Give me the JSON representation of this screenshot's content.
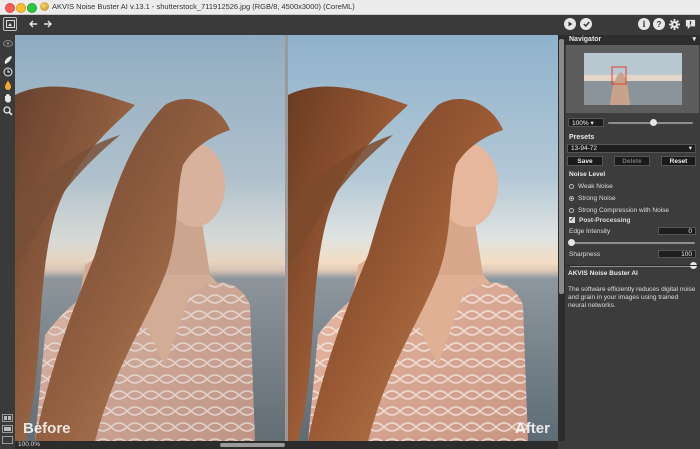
{
  "window": {
    "title": "AKVIS Noise Buster AI v.13.1 - shutterstock_711912526.jpg (RGB/8, 4500x3000) (CoreML)"
  },
  "toolbar": {
    "back_icon": "arrow-left",
    "forward_icon": "arrow-right",
    "run_icon": "play",
    "apply_icon": "check",
    "info_icon": "i",
    "help_icon": "?",
    "settings_icon": "gear",
    "feedback_icon": "!"
  },
  "canvas": {
    "before_label": "Before",
    "after_label": "After",
    "zoom": "100.0%"
  },
  "navigator": {
    "title": "Navigator",
    "zoom_value": "100%",
    "zoom_fraction": 0.54
  },
  "presets": {
    "title": "Presets",
    "selected": "13-94-72",
    "save_label": "Save",
    "delete_label": "Delete",
    "reset_label": "Reset"
  },
  "noise_level": {
    "title": "Noise Level",
    "options": [
      "Weak Noise",
      "Strong Noise",
      "Strong Compression with Noise"
    ],
    "selected_index": 1
  },
  "post_processing": {
    "label": "Post-Processing",
    "checked": true,
    "edge_intensity_label": "Edge Intensity",
    "edge_intensity_value": "0",
    "sharpness_label": "Sharpness",
    "sharpness_value": "100"
  },
  "about": {
    "title": "AKVIS Noise Buster AI",
    "text": "The software efficiently reduces digital noise and grain in your images using trained neural networks."
  }
}
